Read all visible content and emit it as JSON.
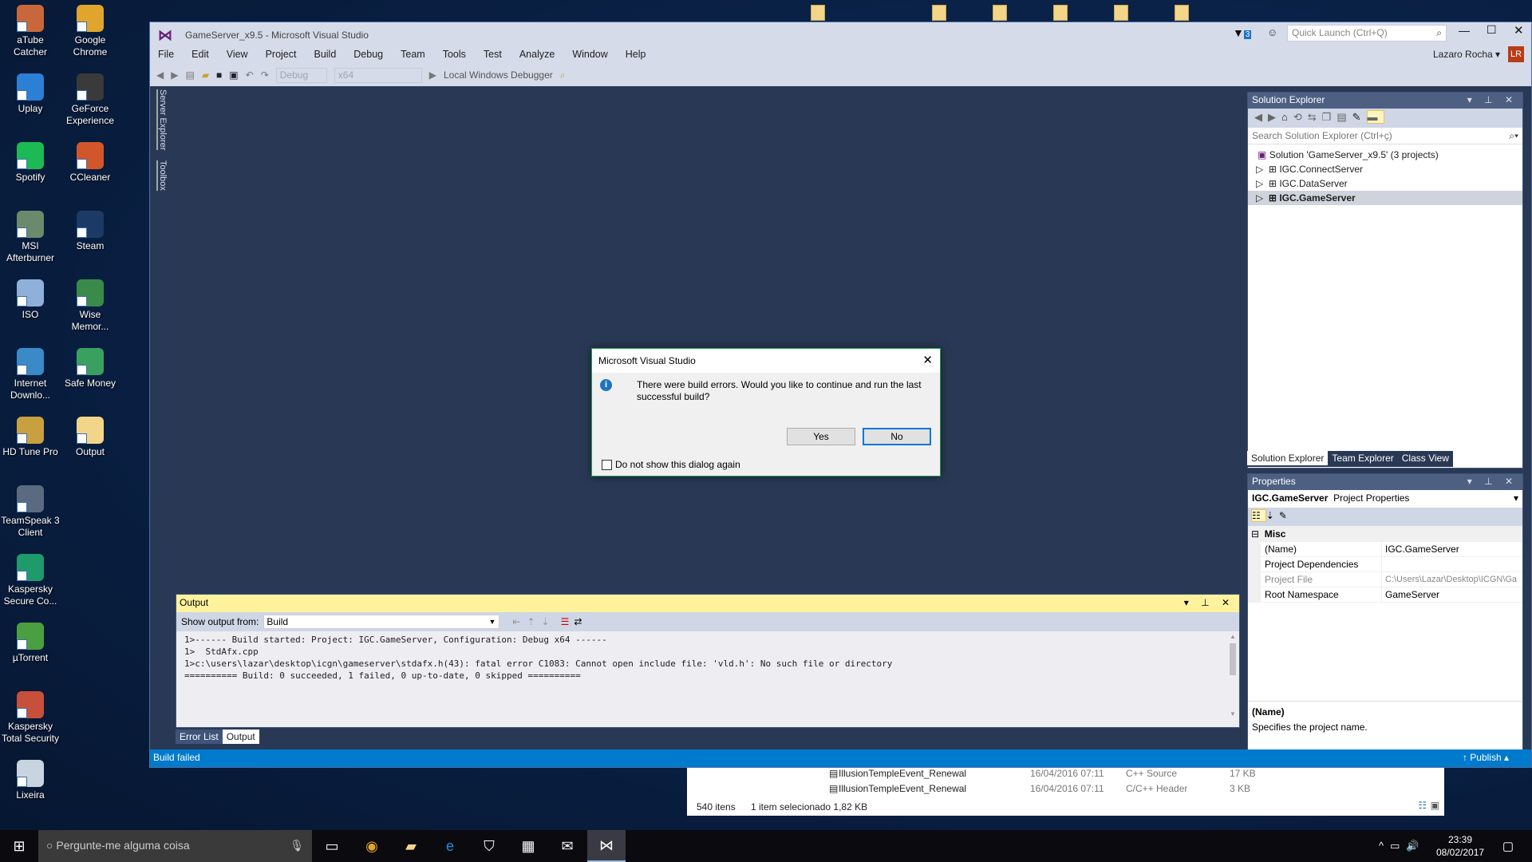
{
  "desktop": {
    "icons": [
      {
        "label": "aTube Catcher",
        "color": "#c8683a"
      },
      {
        "label": "Google Chrome",
        "color": "#e0a52c"
      },
      {
        "label": "Uplay",
        "color": "#2b7fd4"
      },
      {
        "label": "GeForce Experience",
        "color": "#3a3a3a"
      },
      {
        "label": "Spotify",
        "color": "#1db954"
      },
      {
        "label": "CCleaner",
        "color": "#d2562a"
      },
      {
        "label": "MSI Afterburner",
        "color": "#6b8a6b"
      },
      {
        "label": "Steam",
        "color": "#1b3b66"
      },
      {
        "label": "ISO",
        "color": "#8fb0d8"
      },
      {
        "label": "Wise Memor...",
        "color": "#3a8a4a"
      },
      {
        "label": "Internet Downlo...",
        "color": "#3a8ac8"
      },
      {
        "label": "Safe Money",
        "color": "#3aa060"
      },
      {
        "label": "HD Tune Pro",
        "color": "#c8a040"
      },
      {
        "label": "Output",
        "color": "#f3d58a"
      },
      {
        "label": "TeamSpeak 3 Client",
        "color": "#5a6a80"
      },
      {
        "label": "Kaspersky Secure Co...",
        "color": "#1f9a6a"
      },
      {
        "label": "µTorrent",
        "color": "#4aa040"
      },
      {
        "label": "Kaspersky Total Security",
        "color": "#c8503a"
      },
      {
        "label": "Lixeira",
        "color": "#c8d4e0"
      }
    ]
  },
  "vs": {
    "title": "GameServer_x9.5 - Microsoft Visual Studio",
    "menu": [
      "File",
      "Edit",
      "View",
      "Project",
      "Build",
      "Debug",
      "Team",
      "Tools",
      "Test",
      "Analyze",
      "Window",
      "Help"
    ],
    "notification_count": "3",
    "quick_launch_placeholder": "Quick Launch (Ctrl+Q)",
    "user_name": "Lazaro Rocha",
    "user_initials": "LR",
    "toolbar": {
      "configuration": "Debug",
      "platform": "x64",
      "debugger": "Local Windows Debugger"
    },
    "side_tabs": [
      "Server Explorer",
      "Toolbox"
    ],
    "solution_explorer": {
      "title": "Solution Explorer",
      "search_placeholder": "Search Solution Explorer (Ctrl+ç)",
      "solution": "Solution 'GameServer_x9.5' (3 projects)",
      "projects": [
        "IGC.ConnectServer",
        "IGC.DataServer",
        "IGC.GameServer"
      ],
      "selected_project": "IGC.GameServer",
      "tabs": [
        "Solution Explorer",
        "Team Explorer",
        "Class View"
      ]
    },
    "properties": {
      "title": "Properties",
      "object_name": "IGC.GameServer",
      "object_type": "Project Properties",
      "category": "Misc",
      "rows": [
        {
          "key": "(Name)",
          "value": "IGC.GameServer"
        },
        {
          "key": "Project Dependencies",
          "value": ""
        },
        {
          "key": "Project File",
          "value": "C:\\Users\\Lazar\\Desktop\\ICGN\\Ga"
        },
        {
          "key": "Root Namespace",
          "value": "GameServer"
        }
      ],
      "desc_title": "(Name)",
      "desc_text": "Specifies the project name."
    },
    "output": {
      "title": "Output",
      "show_from_label": "Show output from:",
      "source": "Build",
      "lines": [
        "1>------ Build started: Project: IGC.GameServer, Configuration: Debug x64 ------",
        "1>  StdAfx.cpp",
        "1>c:\\users\\lazar\\desktop\\icgn\\gameserver\\stdafx.h(43): fatal error C1083: Cannot open include file: 'vld.h': No such file or directory",
        "========== Build: 0 succeeded, 1 failed, 0 up-to-date, 0 skipped =========="
      ],
      "tabs": [
        "Error List",
        "Output"
      ]
    },
    "status": {
      "text": "Build failed",
      "publish": "Publish"
    },
    "accent": "#007acc"
  },
  "dialog": {
    "title": "Microsoft Visual Studio",
    "message": "There were build errors. Would you like to continue and run the last successful build?",
    "yes": "Yes",
    "no": "No",
    "checkbox": "Do not show this dialog again",
    "checked": false
  },
  "explorer": {
    "files": [
      {
        "name": "IllusionTempleEvent_Renewal",
        "date": "16/04/2016 07:11",
        "type": "C++ Source",
        "size": "17 KB"
      },
      {
        "name": "IllusionTempleEvent_Renewal",
        "date": "16/04/2016 07:11",
        "type": "C/C++ Header",
        "size": "3 KB"
      }
    ],
    "count": "540 itens",
    "selection": "1 item selecionado  1,82 KB"
  },
  "taskbar": {
    "search_placeholder": "Pergunte-me alguma coisa",
    "time": "23:39",
    "date": "08/02/2017"
  }
}
